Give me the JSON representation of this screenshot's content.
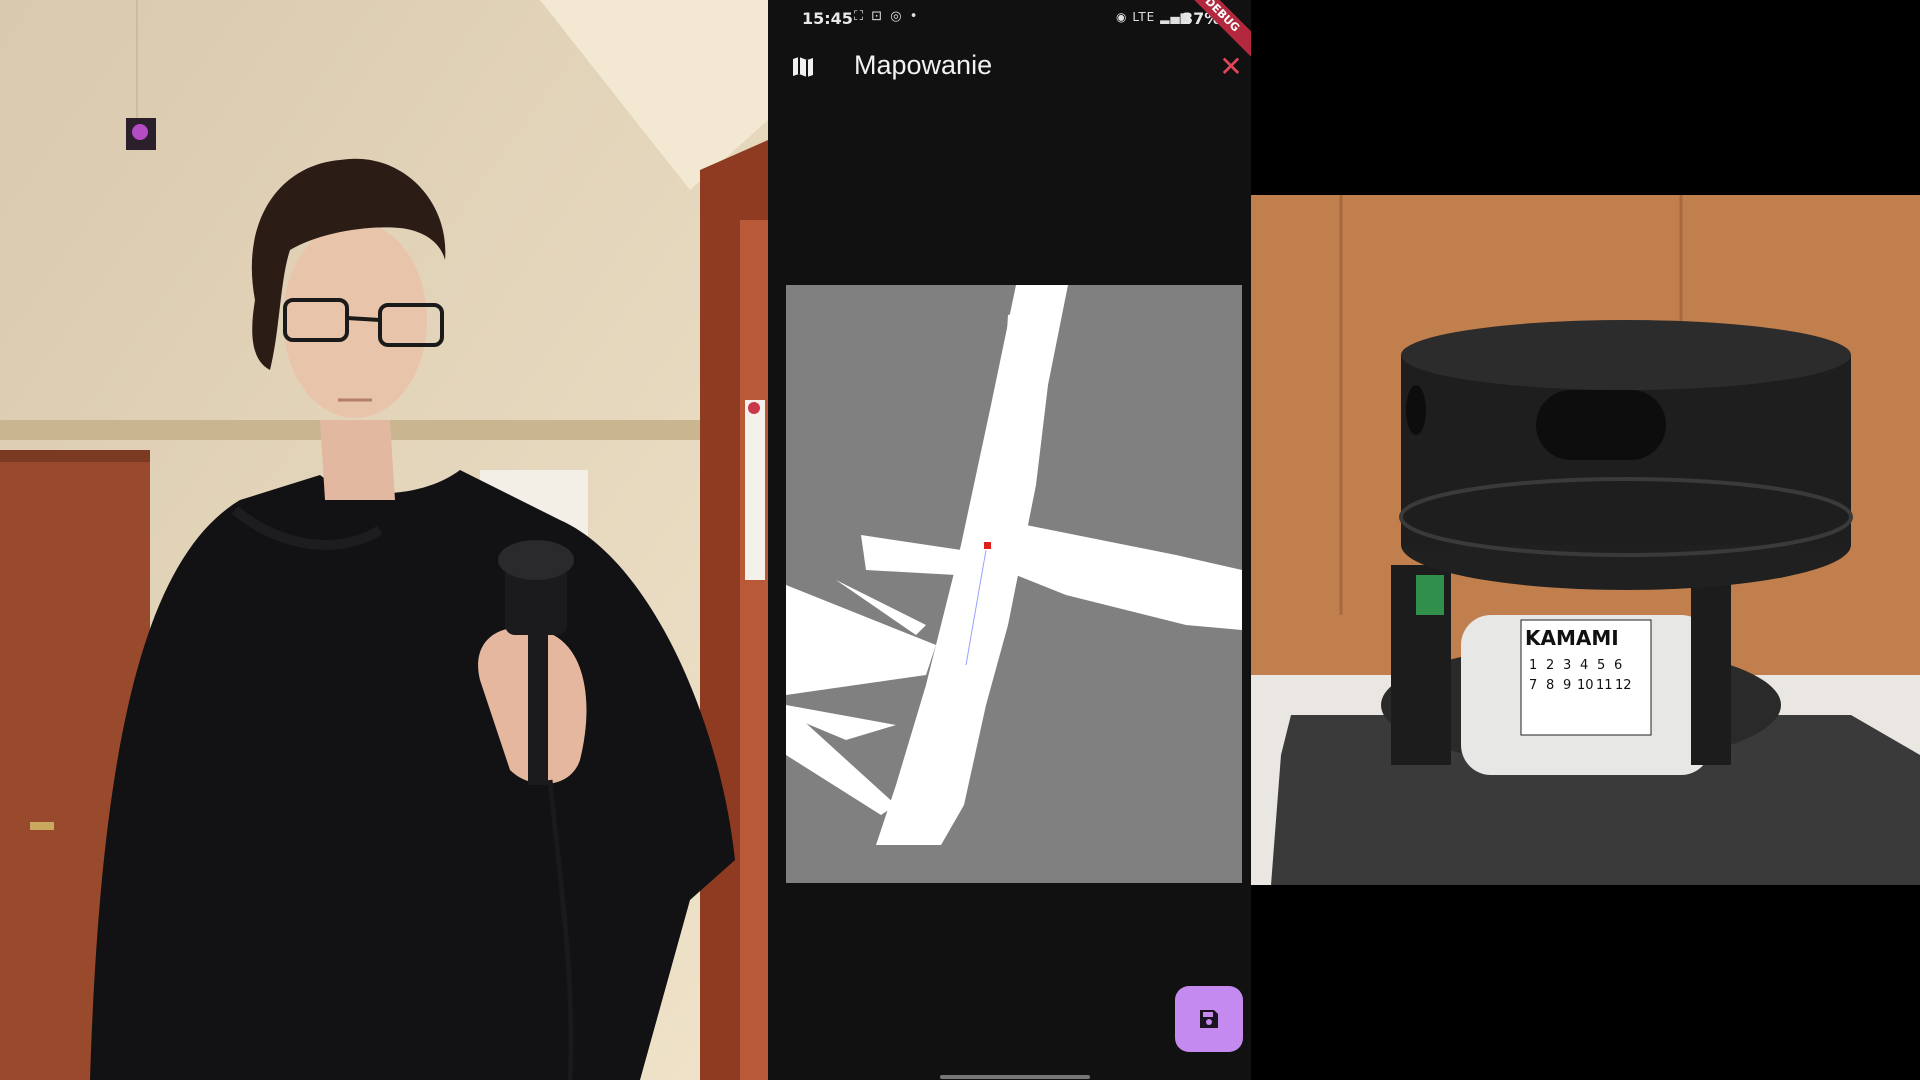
{
  "status_bar": {
    "time": "15:45",
    "left_icons": "⛶ ⊡ ◎ •",
    "network": "LTE",
    "battery": "37%",
    "debug_banner": "DEBUG"
  },
  "app_bar": {
    "title": "Mapowanie",
    "leading_icon": "map-icon",
    "close_icon": "close-icon",
    "close_color": "#e0455a"
  },
  "map": {
    "background_color": "#808080",
    "free_space_color": "#ffffff",
    "robot_marker_color": "#e0201a"
  },
  "fab": {
    "icon": "save-icon",
    "color": "#c58af0"
  },
  "product_photo": {
    "label_brand": "KAMAMI",
    "label_numbers_row1": [
      "1",
      "2",
      "3",
      "4",
      "5",
      "6"
    ],
    "label_numbers_row2": [
      "7",
      "8",
      "9",
      "10",
      "11",
      "12"
    ]
  },
  "colors": {
    "phone_background": "#111111",
    "text_primary": "#f2f2f2"
  }
}
